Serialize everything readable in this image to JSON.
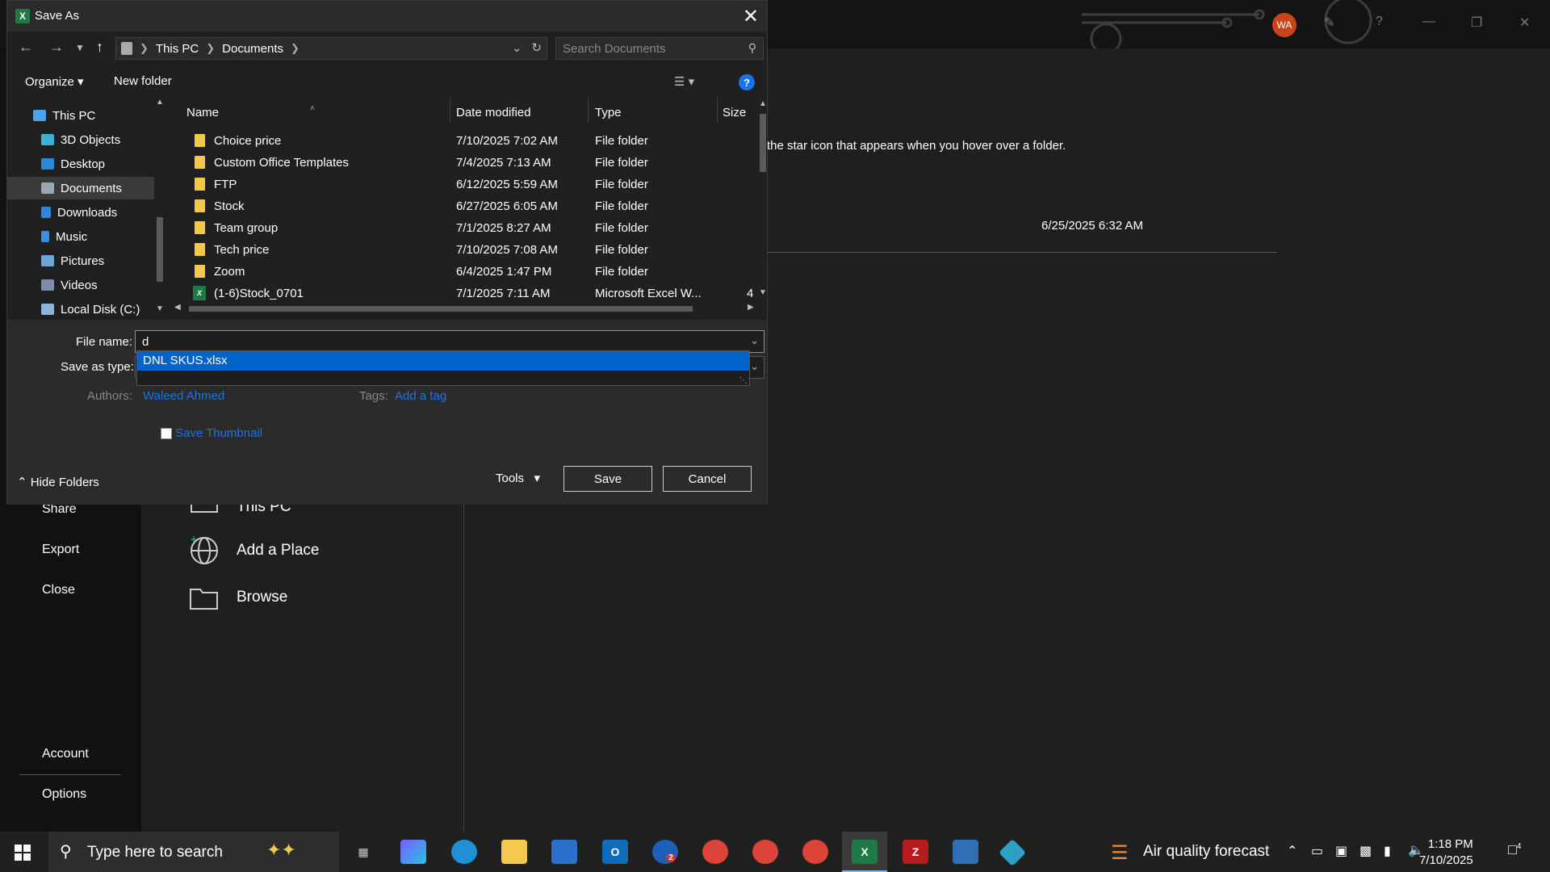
{
  "backstage": {
    "avatar": "WA",
    "nav": [
      "Share",
      "Export",
      "Close",
      "Account",
      "Options"
    ],
    "places": [
      "This PC",
      "Add a Place",
      "Browse"
    ],
    "hint": "the star icon that appears when you hover over a folder.",
    "recent_date": "6/25/2025 6:32 AM"
  },
  "dialog": {
    "title": "Save As",
    "breadcrumb": [
      "This PC",
      "Documents"
    ],
    "search_placeholder": "Search Documents",
    "organize": "Organize",
    "new_folder": "New folder",
    "tree": [
      "This PC",
      "3D Objects",
      "Desktop",
      "Documents",
      "Downloads",
      "Music",
      "Pictures",
      "Videos",
      "Local Disk (C:)"
    ],
    "selected_tree_item": "Documents",
    "columns": [
      "Name",
      "Date modified",
      "Type",
      "Size"
    ],
    "files": [
      {
        "name": "Choice price",
        "date": "7/10/2025 7:02 AM",
        "type": "File folder",
        "size": "",
        "icon": "folder-icon"
      },
      {
        "name": "Custom Office Templates",
        "date": "7/4/2025 7:13 AM",
        "type": "File folder",
        "size": "",
        "icon": "folder-icon"
      },
      {
        "name": "FTP",
        "date": "6/12/2025 5:59 AM",
        "type": "File folder",
        "size": "",
        "icon": "folder-icon"
      },
      {
        "name": "Stock",
        "date": "6/27/2025 6:05 AM",
        "type": "File folder",
        "size": "",
        "icon": "folder-icon"
      },
      {
        "name": "Team group",
        "date": "7/1/2025 8:27 AM",
        "type": "File folder",
        "size": "",
        "icon": "folder-icon"
      },
      {
        "name": "Tech price",
        "date": "7/10/2025 7:08 AM",
        "type": "File folder",
        "size": "",
        "icon": "folder-icon"
      },
      {
        "name": "Zoom",
        "date": "6/4/2025 1:47 PM",
        "type": "File folder",
        "size": "",
        "icon": "folder-icon"
      },
      {
        "name": "(1-6)Stock_0701",
        "date": "7/1/2025 7:11 AM",
        "type": "Microsoft Excel W...",
        "size": "4",
        "icon": "excel-file-icon"
      }
    ],
    "file_name_label": "File name:",
    "file_name_value": "d",
    "autocomplete": "DNL SKUS.xlsx",
    "save_as_type_label": "Save as type:",
    "authors_label": "Authors:",
    "authors_value": "Waleed Ahmed",
    "tags_label": "Tags:",
    "tags_value": "Add a tag",
    "save_thumbnail": "Save Thumbnail",
    "hide_folders": "Hide Folders",
    "tools": "Tools",
    "save": "Save",
    "cancel": "Cancel"
  },
  "taskbar": {
    "search": "Type here to search",
    "weather": "Air quality forecast",
    "time": "1:18 PM",
    "date": "7/10/2025",
    "outlook_badge": "2",
    "notifications": "4"
  },
  "colors": {
    "accent": "#0063c7",
    "link": "#1a73e8",
    "excel": "#1d7a44",
    "folder": "#f2c94c"
  }
}
